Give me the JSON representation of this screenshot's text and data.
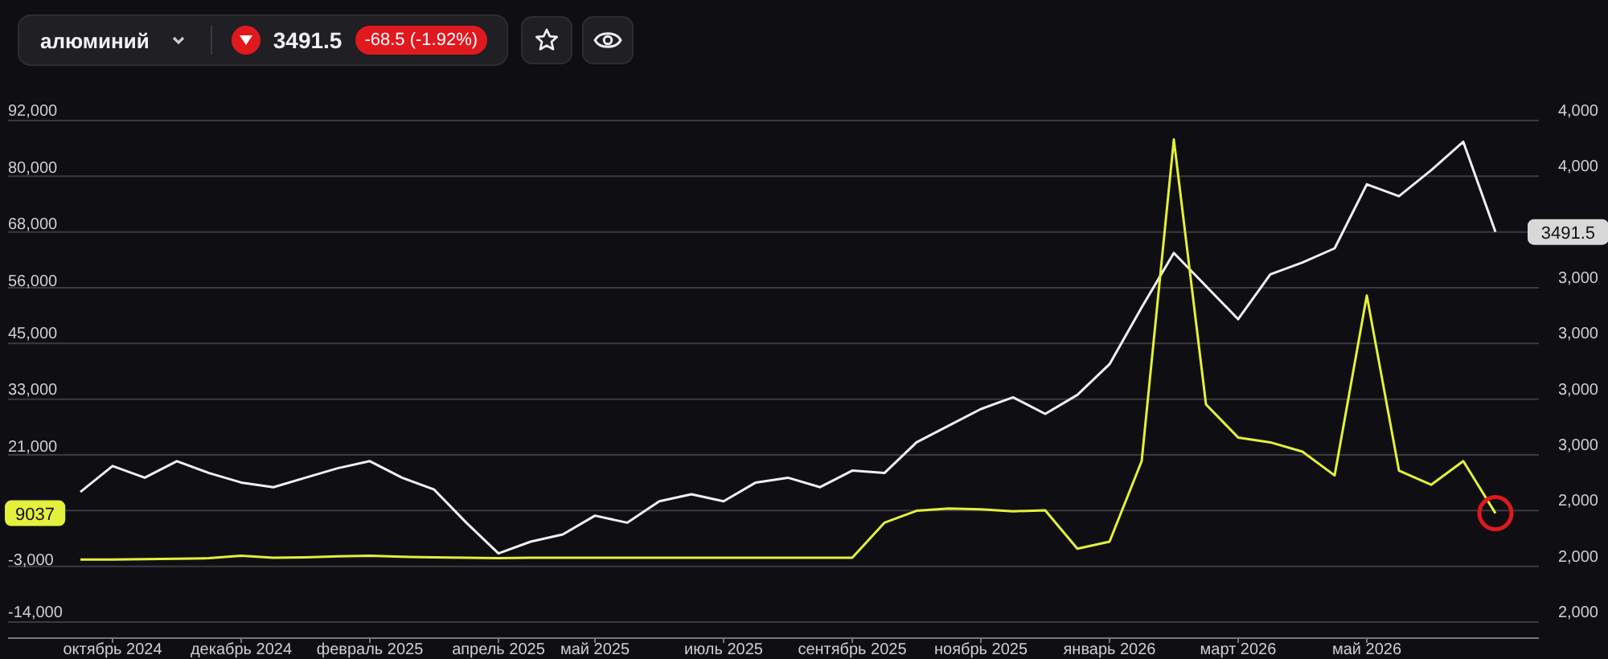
{
  "header": {
    "instrument": "алюминий",
    "price": "3491.5",
    "change": "-68.5 (-1.92%)",
    "buttons": [
      {
        "kind": "star"
      },
      {
        "kind": "eye"
      }
    ]
  },
  "chart": {
    "chart_data": {
      "type": "line",
      "categories": [
        null,
        "октябрь 2024",
        null,
        null,
        null,
        "декабрь 2024",
        null,
        null,
        null,
        "февраль 2025",
        null,
        null,
        null,
        "апрель 2025",
        null,
        null,
        "май 2025",
        null,
        null,
        null,
        "июль 2025",
        null,
        null,
        null,
        "сентябрь 2025",
        null,
        null,
        null,
        "ноябрь 2025",
        null,
        null,
        null,
        "январь 2026",
        null,
        null,
        null,
        "март 2026",
        null,
        null,
        null,
        "май 2026",
        null,
        null,
        null,
        null
      ],
      "ylim": [
        -14000,
        92000
      ],
      "yticks": [
        {
          "value": -14000,
          "label": "-14,000"
        },
        {
          "value": -3000,
          "label": "-3,000"
        },
        {
          "value": 21000,
          "label": "21,000"
        },
        {
          "value": 33000,
          "label": "33,000"
        },
        {
          "value": 45000,
          "label": "45,000"
        },
        {
          "value": 56000,
          "label": "56,000"
        },
        {
          "value": 68000,
          "label": "68,000"
        },
        {
          "value": 80000,
          "label": "80,000"
        },
        {
          "value": 92000,
          "label": "92,000"
        }
      ],
      "grid": true,
      "series": [
        {
          "color": "#f0f0f0",
          "values": [
            13500,
            19000,
            16500,
            20000,
            17500,
            15500,
            14500,
            16500,
            18500,
            20000,
            16500,
            14000,
            7000,
            500,
            3000,
            4500,
            8500,
            7000,
            11500,
            13000,
            11500,
            15500,
            16500,
            14500,
            18000,
            17500,
            24000,
            27500,
            31000,
            33500,
            30000,
            34000,
            40500,
            52500,
            64000,
            57000,
            50000,
            59500,
            62000,
            65000,
            78500,
            76000,
            81500,
            87500,
            68500
          ]
        },
        {
          "color": "#e3f03c",
          "values": [
            -800,
            -800,
            -700,
            -600,
            -500,
            0,
            -400,
            -300,
            -100,
            0,
            -200,
            -300,
            -400,
            -500,
            -400,
            -400,
            -400,
            -400,
            -400,
            -400,
            -400,
            -400,
            -400,
            -400,
            -400,
            7000,
            9500,
            10000,
            9800,
            9400,
            9600,
            1500,
            3000,
            20000,
            88000,
            32000,
            25000,
            24000,
            22000,
            17000,
            55000,
            18000,
            15000,
            20000,
            9000
          ]
        }
      ]
    },
    "left_badge": "9037",
    "right_axis": [
      {
        "label": "4,000"
      },
      {
        "label": "4,000"
      },
      {
        "badge": "3491.5"
      },
      {
        "label": "3,000"
      },
      {
        "label": "3,000"
      },
      {
        "label": "3,000"
      },
      {
        "label": "3,000"
      },
      {
        "label": "2,000"
      },
      {
        "label": "2,000"
      },
      {
        "label": "2,000"
      }
    ]
  }
}
